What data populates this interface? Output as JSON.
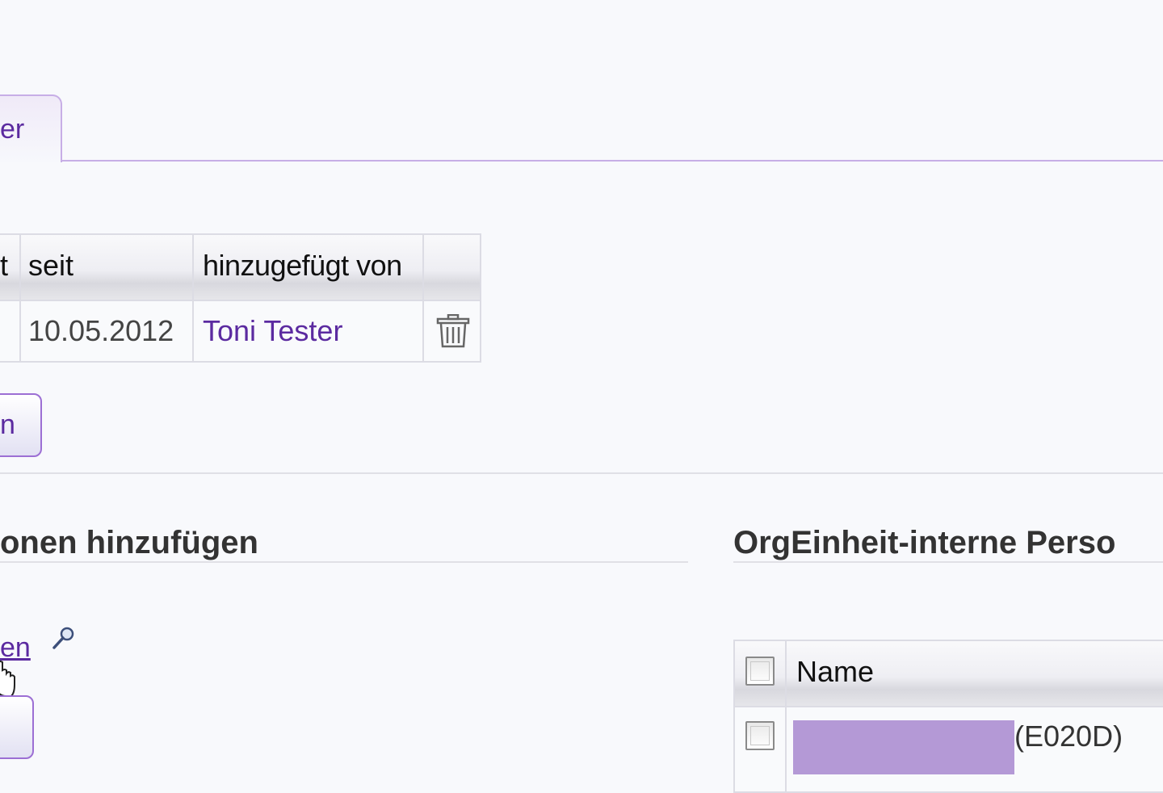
{
  "tab": {
    "label": "er"
  },
  "table": {
    "headers": [
      "t",
      "seit",
      "hinzugefügt von",
      ""
    ],
    "rows": [
      {
        "seit": "10.05.2012",
        "added_by": "Toni Tester"
      }
    ]
  },
  "buttons": {
    "top_label": "n"
  },
  "sections": {
    "left_heading": "onen hinzufügen",
    "right_heading": "OrgEinheit-interne Perso"
  },
  "search_link": "en",
  "right_table": {
    "header_name": "Name",
    "rows": [
      {
        "code": "(E020D)",
        "redacted_color": "#b499d6"
      }
    ]
  },
  "colors": {
    "accent": "#5b2aa0",
    "border_accent": "#c7aee6",
    "button_border": "#9c6fd4"
  },
  "icons": [
    "trash-icon",
    "search-icon",
    "hand-cursor-icon"
  ]
}
